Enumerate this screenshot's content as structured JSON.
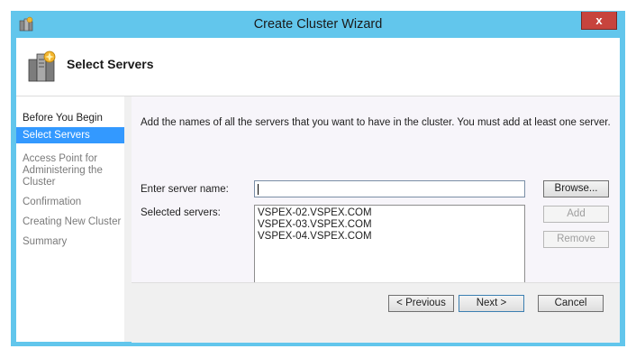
{
  "window": {
    "title": "Create Cluster Wizard",
    "close_label": "x"
  },
  "header": {
    "title": "Select Servers"
  },
  "sidebar": {
    "items": [
      {
        "label": "Before You Begin",
        "state": "done"
      },
      {
        "label": "Select Servers",
        "state": "active"
      },
      {
        "label": "Access Point for Administering the Cluster",
        "state": "pending"
      },
      {
        "label": "Confirmation",
        "state": "pending"
      },
      {
        "label": "Creating New Cluster",
        "state": "pending"
      },
      {
        "label": "Summary",
        "state": "pending"
      }
    ]
  },
  "main": {
    "description": "Add the names of all the servers that you want to have in the cluster. You must add at least one server.",
    "server_name_label": "Enter server name:",
    "server_name_value": "",
    "selected_label": "Selected servers:",
    "selected_servers": [
      "VSPEX-02.VSPEX.COM",
      "VSPEX-03.VSPEX.COM",
      "VSPEX-04.VSPEX.COM"
    ],
    "browse_label": "Browse...",
    "add_label": "Add",
    "remove_label": "Remove"
  },
  "footer": {
    "previous_label": "< Previous",
    "next_label": "Next >",
    "cancel_label": "Cancel"
  },
  "colors": {
    "window_frame": "#62c6ec",
    "selection": "#3399ff",
    "close": "#c7443d"
  }
}
